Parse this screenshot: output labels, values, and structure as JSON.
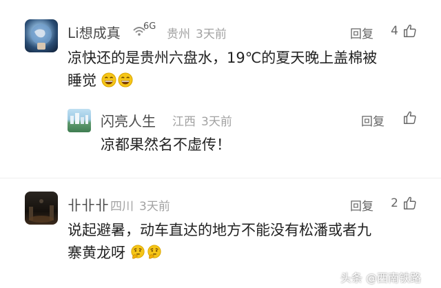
{
  "comments": [
    {
      "user": "Li想成真",
      "network": "6G",
      "location": "贵州",
      "time": "3天前",
      "reply_label": "回复",
      "likes": "4",
      "text_lines": [
        "凉快还的是贵州六盘水，19℃的夏天晚上盖棉被",
        "睡觉"
      ],
      "emojis": [
        "grin-emoji",
        "grin-emoji"
      ]
    },
    {
      "user": "闪亮人生",
      "location": "江西",
      "time": "3天前",
      "reply_label": "回复",
      "text_lines": [
        "凉都果然名不虚传！"
      ]
    },
    {
      "user": "卝卝卝",
      "location": "四川",
      "time": "3天前",
      "reply_label": "回复",
      "likes": "2",
      "text_lines": [
        "说起避暑，动车直达的地方不能没有松潘或者九",
        "寨黄龙呀"
      ],
      "emojis": [
        "thinking-emoji",
        "thinking-emoji"
      ]
    }
  ],
  "watermark": "头条 @西南铁路",
  "colors": {
    "accent": "#f5c518",
    "meta": "#a2a2a2",
    "text": "#222222"
  }
}
